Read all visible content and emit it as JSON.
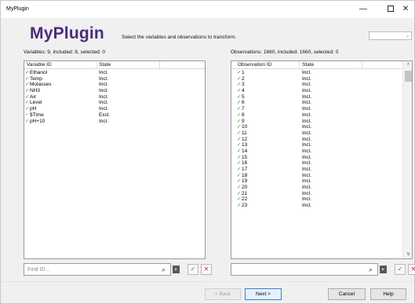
{
  "window": {
    "title": "MyPlugin",
    "minimize_glyph": "—",
    "close_glyph": "✕"
  },
  "header": {
    "plugin_title": "MyPlugin",
    "subtitle": "Select the variables and observations to transform.",
    "combo_value": ""
  },
  "variables": {
    "summary": "Variables: 9, included: 8, selected: 0",
    "columns": [
      "Variable ID",
      "State"
    ],
    "rows": [
      {
        "mark": "✓",
        "id": "Ethanol",
        "state": "Incl."
      },
      {
        "mark": "✓",
        "id": "Temp",
        "state": "Incl."
      },
      {
        "mark": "✓",
        "id": "Molasses",
        "state": "Incl."
      },
      {
        "mark": "✓",
        "id": "NH3",
        "state": "Incl."
      },
      {
        "mark": "✓",
        "id": "Air",
        "state": "Incl."
      },
      {
        "mark": "✓",
        "id": "Level",
        "state": "Incl."
      },
      {
        "mark": "✓",
        "id": "pH",
        "state": "Incl."
      },
      {
        "mark": "−",
        "id": "$Time",
        "state": "Excl."
      },
      {
        "mark": "✓",
        "id": "pH+10",
        "state": "Incl."
      }
    ],
    "find_placeholder": "Find ID..."
  },
  "observations": {
    "summary": "Observations: 1660, included: 1660, selected: 0",
    "columns": [
      "Observation ID",
      "State"
    ],
    "rows": [
      {
        "mark": "✓",
        "id": "1",
        "state": "Incl."
      },
      {
        "mark": "✓",
        "id": "2",
        "state": "Incl."
      },
      {
        "mark": "✓",
        "id": "3",
        "state": "Incl."
      },
      {
        "mark": "✓",
        "id": "4",
        "state": "Incl."
      },
      {
        "mark": "✓",
        "id": "5",
        "state": "Incl."
      },
      {
        "mark": "✓",
        "id": "6",
        "state": "Incl."
      },
      {
        "mark": "✓",
        "id": "7",
        "state": "Incl."
      },
      {
        "mark": "✓",
        "id": "8",
        "state": "Incl."
      },
      {
        "mark": "✓",
        "id": "9",
        "state": "Incl."
      },
      {
        "mark": "✓",
        "id": "10",
        "state": "Incl."
      },
      {
        "mark": "✓",
        "id": "11",
        "state": "Incl."
      },
      {
        "mark": "✓",
        "id": "12",
        "state": "Incl."
      },
      {
        "mark": "✓",
        "id": "13",
        "state": "Incl."
      },
      {
        "mark": "✓",
        "id": "14",
        "state": "Incl."
      },
      {
        "mark": "✓",
        "id": "15",
        "state": "Incl."
      },
      {
        "mark": "✓",
        "id": "16",
        "state": "Incl."
      },
      {
        "mark": "✓",
        "id": "17",
        "state": "Incl."
      },
      {
        "mark": "✓",
        "id": "18",
        "state": "Incl."
      },
      {
        "mark": "✓",
        "id": "19",
        "state": "Incl."
      },
      {
        "mark": "✓",
        "id": "20",
        "state": "Incl."
      },
      {
        "mark": "✓",
        "id": "21",
        "state": "Incl."
      },
      {
        "mark": "✓",
        "id": "22",
        "state": "Incl."
      },
      {
        "mark": "✓",
        "id": "23",
        "state": "Incl."
      }
    ],
    "find_value": ""
  },
  "icons": {
    "search": "⌕",
    "next_arrow": "▸",
    "include": "✓",
    "exclude": "✕",
    "scroll_up": "^",
    "scroll_down": "v",
    "combo_chevron": "⌄"
  },
  "buttons": {
    "back": "< Back",
    "next": "Next >",
    "cancel": "Cancel",
    "help": "Help"
  },
  "colors": {
    "title_purple": "#4a2c7a",
    "check_green": "#2e9a2e",
    "exclude_red": "#c9302c",
    "accent_blue": "#3c7fd1"
  }
}
